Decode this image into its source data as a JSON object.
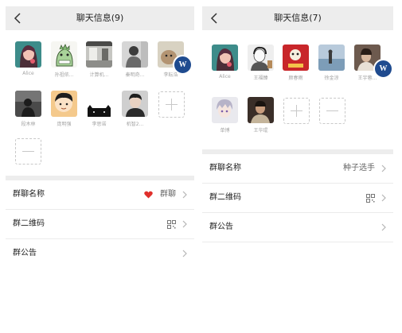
{
  "left": {
    "title": "聊天信息(9)",
    "members": [
      {
        "name": "Alice",
        "icon": "girl-portrait-avatar"
      },
      {
        "name": "孙祖侬...",
        "icon": "cartoon-dinosaur-avatar"
      },
      {
        "name": "计算机...",
        "icon": "room-photo-avatar"
      },
      {
        "name": "秦明奇...",
        "icon": "person-photo-avatar"
      },
      {
        "name": "李耘浩",
        "icon": "dog-photo-avatar"
      },
      {
        "name": "段木林",
        "icon": "silhouette-avatar"
      },
      {
        "name": "庞明强",
        "icon": "cartoon-boy-avatar"
      },
      {
        "name": "李思诺",
        "icon": "black-cat-avatar"
      },
      {
        "name": "机智2...",
        "icon": "man-portrait-avatar"
      }
    ],
    "rows": [
      {
        "label": "群聊名称",
        "value": "群聊",
        "icon": "heart-icon"
      },
      {
        "label": "群二维码",
        "value": "",
        "icon": "qr-code-icon"
      },
      {
        "label": "群公告",
        "value": "",
        "icon": ""
      }
    ],
    "badge": "W"
  },
  "right": {
    "title": "聊天信息(7)",
    "members": [
      {
        "name": "Alice",
        "icon": "girl-portrait-avatar"
      },
      {
        "name": "王福臻",
        "icon": "sketch-portrait-avatar"
      },
      {
        "name": "颜春雨",
        "icon": "red-poster-avatar"
      },
      {
        "name": "徐金涼",
        "icon": "seaside-photo-avatar"
      },
      {
        "name": "王宇蓉...",
        "icon": "portrait-photo-avatar"
      },
      {
        "name": "单博",
        "icon": "anime-boy-avatar"
      },
      {
        "name": "王华琨",
        "icon": "dark-portrait-avatar"
      }
    ],
    "rows": [
      {
        "label": "群聊名称",
        "value": "种子选手",
        "icon": ""
      },
      {
        "label": "群二维码",
        "value": "",
        "icon": "qr-code-icon"
      },
      {
        "label": "群公告",
        "value": "",
        "icon": ""
      }
    ],
    "badge": "W"
  },
  "colors": {
    "header_bg": "#ededed",
    "badge_bg": "#1f4b8f",
    "heart": "#e0302c"
  }
}
